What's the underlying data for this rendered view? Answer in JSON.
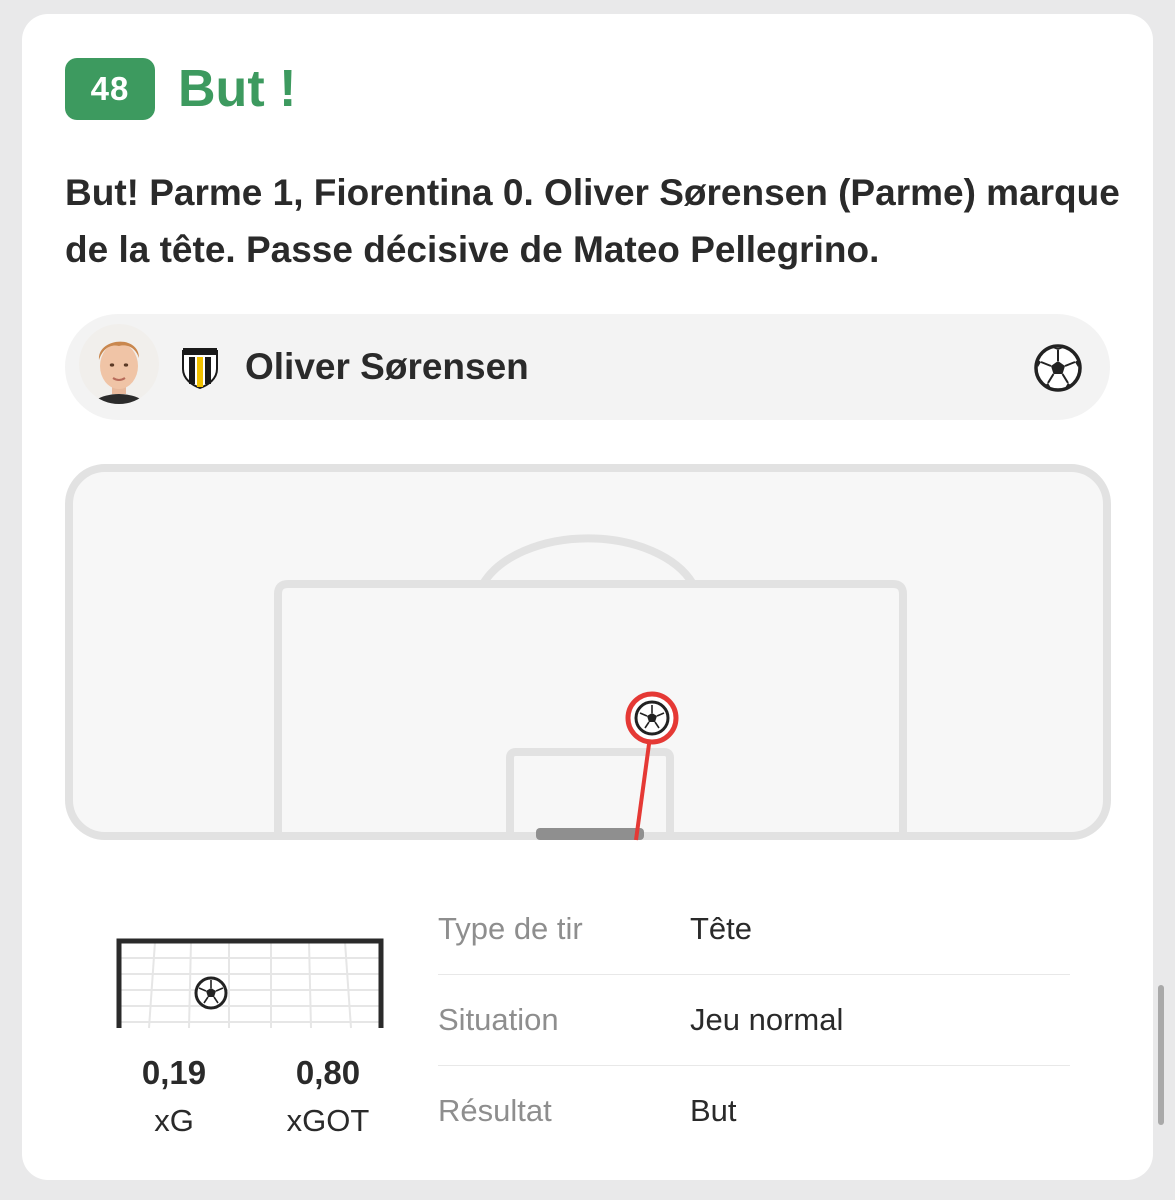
{
  "event": {
    "minute": "48",
    "title": "But !",
    "commentary": "But! Parme 1, Fiorentina 0. Oliver Sørensen (Parme) marque de la tête. Passe décisive de Mateo Pellegrino."
  },
  "player": {
    "name": "Oliver Sørensen",
    "club_badge_icon": "parma-calcio-crest",
    "event_icon": "football-icon"
  },
  "shot_map": {
    "marker_icon": "football-icon",
    "marker_color": "#e53935"
  },
  "stats": {
    "xg": {
      "value": "0,19",
      "label": "xG"
    },
    "xgot": {
      "value": "0,80",
      "label": "xGOT"
    }
  },
  "details": [
    {
      "label": "Type de tir",
      "value": "Tête"
    },
    {
      "label": "Situation",
      "value": "Jeu normal"
    },
    {
      "label": "Résultat",
      "value": "But"
    }
  ],
  "colors": {
    "accent_green": "#3d9a5f",
    "pitch_line": "#e2e2e2",
    "pitch_fill": "#f7f7f7",
    "shot_line": "#e53935"
  }
}
